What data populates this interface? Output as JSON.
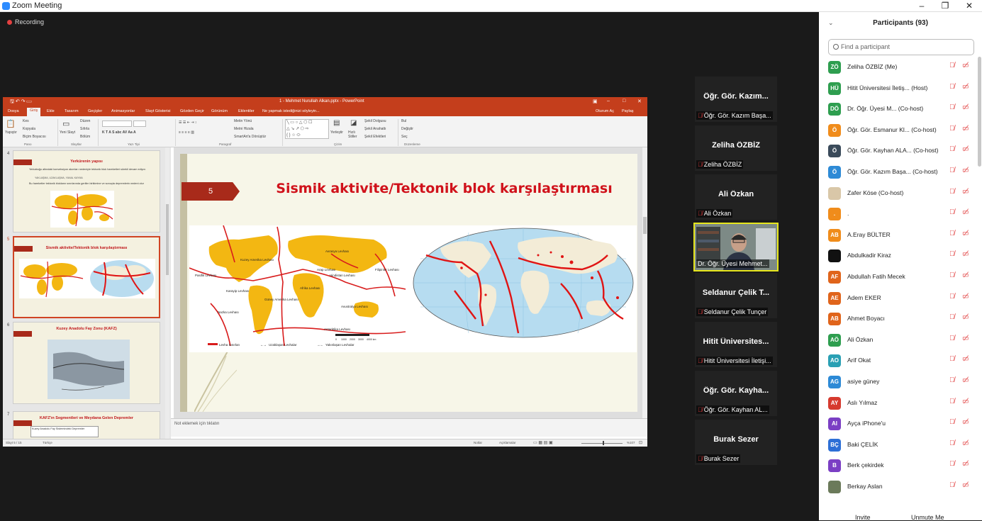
{
  "window": {
    "title": "Zoom Meeting"
  },
  "meeting": {
    "recording_label": "Recording"
  },
  "ppt": {
    "file_title": "1 - Mehmet Nurullah Alkan.pptx - PowerPoint",
    "tabs": [
      "Dosya",
      "Giriş",
      "Ekle",
      "Tasarım",
      "Geçişler",
      "Animasyonlar",
      "Slayt Gösterisi",
      "Gözden Geçir",
      "Görünüm",
      "Eklentiler",
      "Ne yapmak istediğinizi söyleyin..."
    ],
    "tabs_right": [
      "Oturum Aç",
      "Paylaş"
    ],
    "ribbon": {
      "groups": [
        "Pano",
        "Slaytlar",
        "Yazı Tipi",
        "Paragraf",
        "Çizim",
        "Düzenleme"
      ],
      "paste": "Yapıştır",
      "cut": "Kes",
      "copy": "Kopyala",
      "format_painter": "Biçim Boyacısı",
      "new_slide": "Yeni Slayt",
      "layout": "Düzen",
      "reset": "Sıfırla",
      "section": "Bölüm",
      "text_direction": "Metin Yönü",
      "align_text": "Metni Hizala",
      "smartart": "SmartArt'a Dönüştür",
      "arrange": "Yerleştir",
      "quick_styles": "Hızlı Stiller",
      "shape_fill": "Şekil Dolgusu",
      "shape_outline": "Şekil Anahattı",
      "shape_effects": "Şekil Efektleri",
      "find": "Bul",
      "replace": "Değiştir",
      "select": "Seç"
    },
    "thumbs": [
      {
        "num": "4",
        "title": "Yerkürenin yapısı",
        "bullets": [
          "Yerkabuğu altındaki konveksiyon akımları nedeniyle tektonik blok hareketleri sürekli devam ediyor.",
          "YAKLAŞMA, UZAKLAŞMA, YANAL KAYMA",
          "Bu hareketler tektonik blokların sınırlarında gerilim birikimine ve sonuçta depremlerin nedeni olur"
        ]
      },
      {
        "num": "5",
        "title": "Sismik aktivite/Tektonik blok karşılaştırması"
      },
      {
        "num": "6",
        "title": "Kuzey Anadolu Fay Zonu (KAFZ)"
      },
      {
        "num": "7",
        "title": "KAFZ'ın Segmentleri ve Meydana Gelen Depremler",
        "sub": "Kuzey Anadolu Fay Sistemindeki Depremler"
      }
    ],
    "slide": {
      "number": "5",
      "title": "Sismik aktivite/Tektonik blok karşılaştırması",
      "map_labels": [
        "Avrasya Levhası",
        "Kuzey Amerika Levhası",
        "Pasifik Levhası",
        "Arap Levhası",
        "Hindistan Levhası",
        "Filipinler Levhası",
        "Afrika Levhası",
        "Güney Amerika Levhası",
        "Nazka Levhası",
        "Karayip Levhası",
        "Avustralya Levhası",
        "Antarktika Levhası"
      ],
      "legend": [
        "Levha Sınırları",
        "Uzaklaşan Levhalar",
        "Yakınlaşan Levhalar"
      ],
      "scale": [
        "0",
        "1000",
        "2000",
        "3000",
        "4000 km"
      ]
    },
    "notes_placeholder": "Not eklemek için tıklatın",
    "status_left": [
      "Slayt 5 / 15",
      "Türkçe"
    ],
    "status_right": [
      "Notlar",
      "Açıklamalar",
      "%107"
    ]
  },
  "gallery": [
    {
      "name": "Öğr. Gör. Kazım...",
      "label": "Öğr. Gör. Kazım Başa..."
    },
    {
      "name": "Zeliha ÖZBİZ",
      "label": "Zeliha ÖZBİZ"
    },
    {
      "name": "Ali Özkan",
      "label": "Ali Özkan"
    },
    {
      "name": "",
      "label": "Dr. Öğr. Üyesi Mehmet..."
    },
    {
      "name": "Seldanur Çelik T...",
      "label": "Seldanur Çelik Tunçer"
    },
    {
      "name": "Hitit Üniversites...",
      "label": "Hitit Üniversitesi İletişi..."
    },
    {
      "name": "Öğr. Gör. Kayha...",
      "label": "Öğr. Gör. Kayhan AL..."
    },
    {
      "name": "Burak Sezer",
      "label": "Burak Sezer"
    }
  ],
  "participants": {
    "title": "Participants (93)",
    "search_placeholder": "Find a participant",
    "list": [
      {
        "initials": "ZÖ",
        "name": "Zeliha ÖZBİZ (Me)",
        "color": "#2e9e4f"
      },
      {
        "initials": "HÜ",
        "name": "Hitit Üniversitesi İletiş... (Host)",
        "color": "#2e9e4f"
      },
      {
        "initials": "DÖ",
        "name": "Dr. Öğr. Üyesi M... (Co-host)",
        "color": "#2e9e4f"
      },
      {
        "initials": "Ö",
        "name": "Öğr. Gör. Esmanur Kl... (Co-host)",
        "color": "#f08c1b"
      },
      {
        "initials": "Ö",
        "name": "Öğr. Gör. Kayhan ALA... (Co-host)",
        "color": "#3a4a5a"
      },
      {
        "initials": "Ö",
        "name": "Öğr. Gör. Kazım Başa... (Co-host)",
        "color": "#2d8ad6"
      },
      {
        "initials": "",
        "name": "Zafer Köse (Co-host)",
        "color": "#d9c7a8"
      },
      {
        "initials": ".",
        "name": ".",
        "color": "#f08c1b"
      },
      {
        "initials": "AB",
        "name": "A.Eray BÜLTER",
        "color": "#f08c1b"
      },
      {
        "initials": "",
        "name": "Abdulkadir Kiraz",
        "color": "#111111"
      },
      {
        "initials": "AF",
        "name": "Abdullah Fatih Mecek",
        "color": "#e0641b"
      },
      {
        "initials": "AE",
        "name": "Adem EKER",
        "color": "#e0641b"
      },
      {
        "initials": "AB",
        "name": "Ahmet Boyacı",
        "color": "#e0641b"
      },
      {
        "initials": "AÖ",
        "name": "Ali Özkan",
        "color": "#2e9e4f"
      },
      {
        "initials": "AO",
        "name": "Arif Okat",
        "color": "#2aa0b4"
      },
      {
        "initials": "AG",
        "name": "asiye güney",
        "color": "#2d8ad6"
      },
      {
        "initials": "AY",
        "name": "Aslı Yılmaz",
        "color": "#d63a2f"
      },
      {
        "initials": "AI",
        "name": "Ayça iPhone'u",
        "color": "#7b3fc4"
      },
      {
        "initials": "BÇ",
        "name": "Baki ÇELİK",
        "color": "#2d6fd6"
      },
      {
        "initials": "B",
        "name": "Berk çekirdek",
        "color": "#7b3fc4"
      },
      {
        "initials": "",
        "name": "Berkay Aslan",
        "color": "#6b7a5a"
      }
    ],
    "invite": "Invite",
    "unmute": "Unmute Me"
  },
  "colors": {
    "ppt_red": "#c43e1c",
    "title_red": "#d0121b",
    "zoom_blue": "#2d8cff",
    "muted_red": "#e03b3b",
    "speaker_border": "#e6e61c"
  }
}
